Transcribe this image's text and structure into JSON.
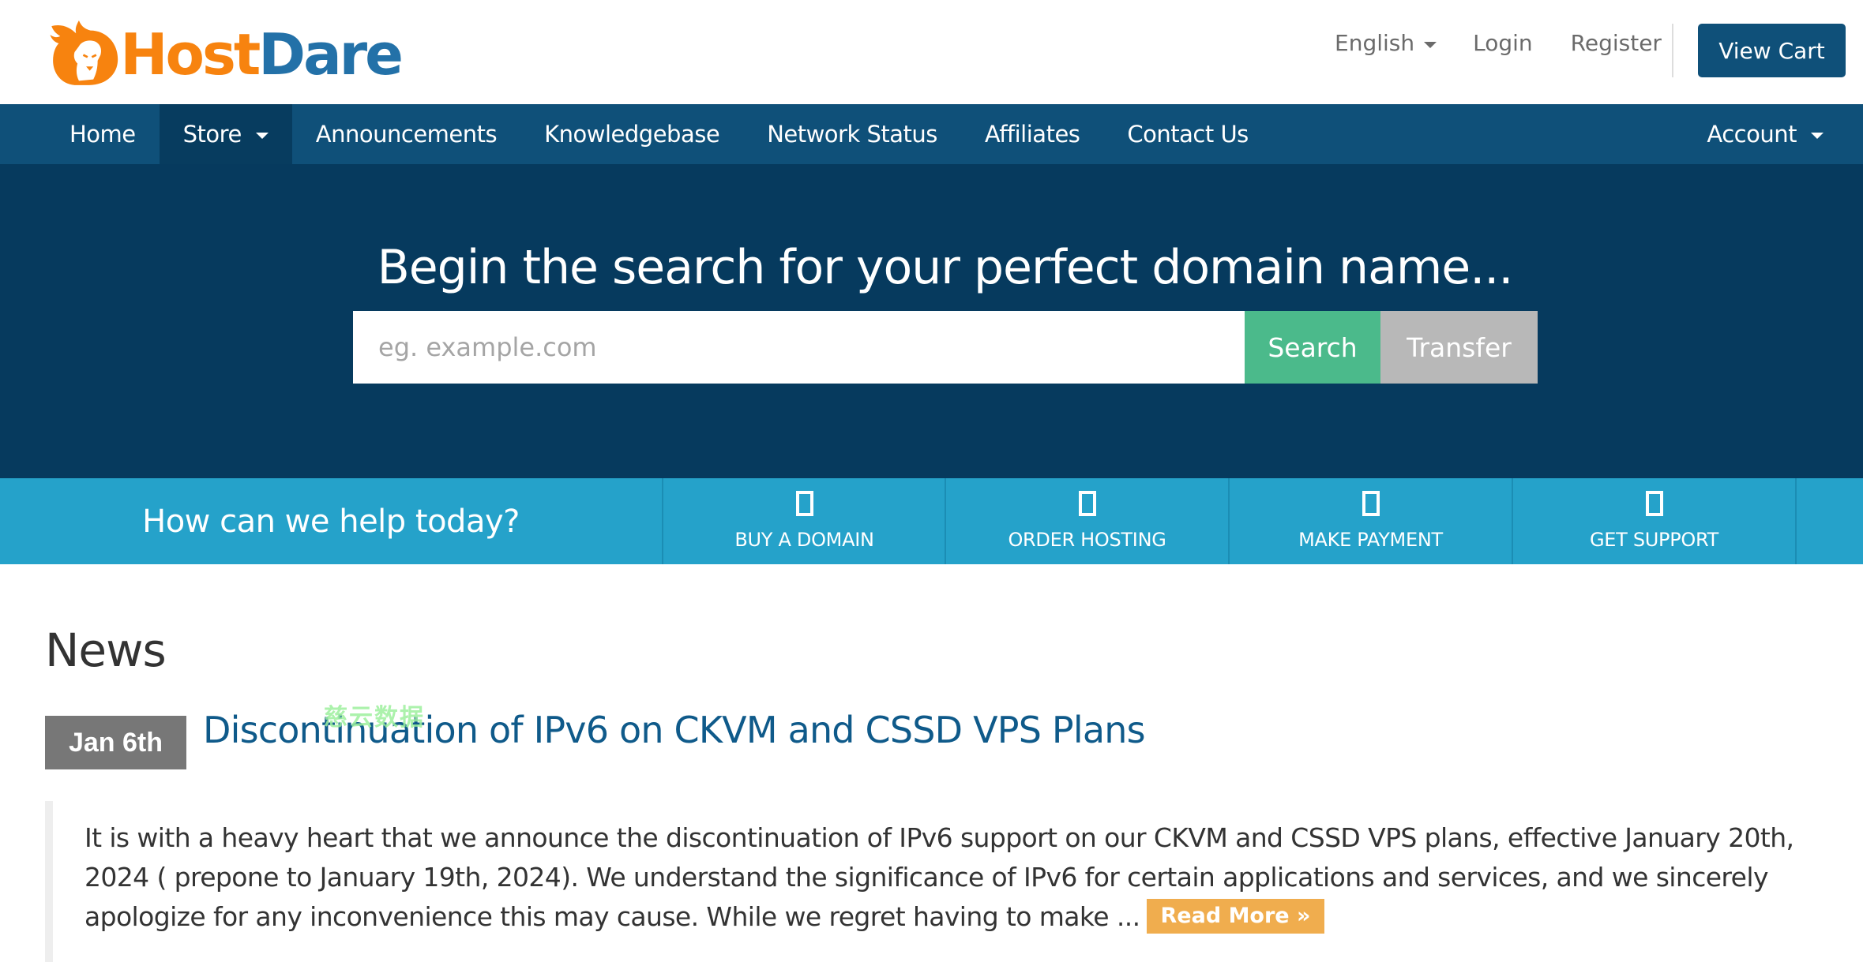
{
  "header": {
    "logo": {
      "part1": "Host",
      "part2": "Dare",
      "icon": "lion-flame-logo-icon"
    },
    "language_label": "English",
    "login_label": "Login",
    "register_label": "Register",
    "view_cart_label": "View Cart"
  },
  "nav": {
    "items": [
      {
        "label": "Home",
        "active": false,
        "dropdown": false
      },
      {
        "label": "Store",
        "active": true,
        "dropdown": true
      },
      {
        "label": "Announcements",
        "active": false,
        "dropdown": false
      },
      {
        "label": "Knowledgebase",
        "active": false,
        "dropdown": false
      },
      {
        "label": "Network Status",
        "active": false,
        "dropdown": false
      },
      {
        "label": "Affiliates",
        "active": false,
        "dropdown": false
      },
      {
        "label": "Contact Us",
        "active": false,
        "dropdown": false
      }
    ],
    "account_label": "Account"
  },
  "hero": {
    "title": "Begin the search for your perfect domain name...",
    "search_placeholder": "eg. example.com",
    "search_value": "",
    "search_button": "Search",
    "transfer_button": "Transfer"
  },
  "help": {
    "title": "How can we help today?",
    "tiles": [
      {
        "label": "BUY A DOMAIN",
        "icon": "missing-glyph-icon"
      },
      {
        "label": "ORDER HOSTING",
        "icon": "missing-glyph-icon"
      },
      {
        "label": "MAKE PAYMENT",
        "icon": "missing-glyph-icon"
      },
      {
        "label": "GET SUPPORT",
        "icon": "missing-glyph-icon"
      }
    ]
  },
  "news": {
    "heading": "News",
    "watermark": "慈云数据",
    "items": [
      {
        "date": "Jan 6th",
        "title": "Discontinuation of IPv6 on CKVM and CSSD VPS Plans",
        "excerpt": "It is with a heavy heart that we announce the discontinuation of IPv6 support on our CKVM and CSSD VPS plans, effective January 20th, 2024 ( prepone to January 19th, 2024). We understand the significance of IPv6 for certain applications and services, and we sincerely apologize for any inconvenience this may cause. While we regret having to make ...",
        "read_more": "Read More »"
      }
    ]
  },
  "colors": {
    "brand_orange": "#f7830f",
    "brand_blue": "#2371a8",
    "nav_bg": "#0f5079",
    "nav_active": "#073c5f",
    "hero_bg": "#063a5e",
    "search_green": "#4bba8b",
    "transfer_gray": "#b8b8b8",
    "help_bg": "#25a2ca",
    "read_more_orange": "#f0ad4e",
    "date_badge_gray": "#777777"
  }
}
